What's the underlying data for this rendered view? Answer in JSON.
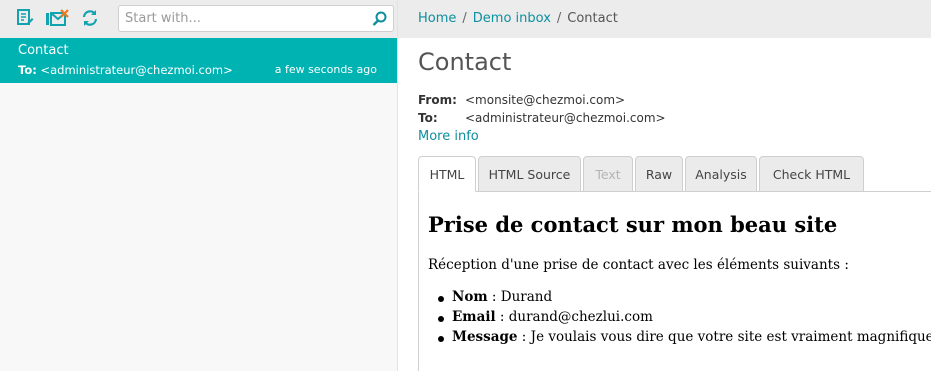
{
  "toolbar": {
    "search_placeholder": "Start with...",
    "icons": [
      "compose-icon",
      "mark-read-delete-icon",
      "refresh-icon",
      "search-icon"
    ],
    "accent_color": "#00b3b3"
  },
  "message_list": [
    {
      "subject": "Contact",
      "to_label": "To:",
      "to": "<administrateur@chezmoi.com>",
      "time": "a few seconds ago",
      "selected": true
    }
  ],
  "breadcrumb": {
    "items": [
      "Home",
      "Demo inbox",
      "Contact"
    ],
    "separator": "/"
  },
  "message": {
    "title": "Contact",
    "from_label": "From:",
    "from": "<monsite@chezmoi.com>",
    "to_label": "To:",
    "to": "<administrateur@chezmoi.com>",
    "more_info": "More info"
  },
  "tabs": [
    {
      "label": "HTML",
      "active": true,
      "disabled": false
    },
    {
      "label": "HTML Source",
      "active": false,
      "disabled": false
    },
    {
      "label": "Text",
      "active": false,
      "disabled": true
    },
    {
      "label": "Raw",
      "active": false,
      "disabled": false
    },
    {
      "label": "Analysis",
      "active": false,
      "disabled": false
    },
    {
      "label": "Check HTML",
      "active": false,
      "disabled": false
    }
  ],
  "email_html": {
    "heading": "Prise de contact sur mon beau site",
    "intro": "Réception d'une prise de contact avec les éléments suivants :",
    "fields": [
      {
        "label": "Nom",
        "sep": " : ",
        "value": "Durand"
      },
      {
        "label": "Email",
        "sep": " : ",
        "value": "durand@chezlui.com"
      },
      {
        "label": "Message",
        "sep": " : ",
        "value": "Je voulais vous dire que votre site est vraiment magnifique !"
      }
    ]
  }
}
